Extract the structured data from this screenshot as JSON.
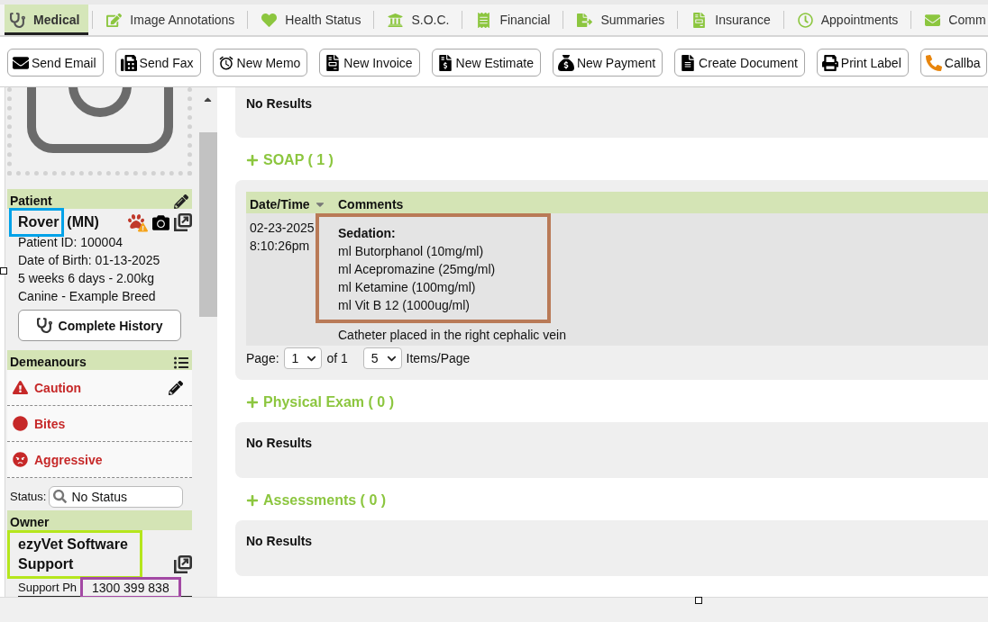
{
  "tabs": [
    {
      "label": "Medical",
      "selected": true
    },
    {
      "label": "Image Annotations",
      "selected": false
    },
    {
      "label": "Health Status",
      "selected": false
    },
    {
      "label": "S.O.C.",
      "selected": false
    },
    {
      "label": "Financial",
      "selected": false
    },
    {
      "label": "Summaries",
      "selected": false
    },
    {
      "label": "Insurance",
      "selected": false
    },
    {
      "label": "Appointments",
      "selected": false
    },
    {
      "label": "Comm",
      "selected": false
    }
  ],
  "toolbar": [
    "Send Email",
    "Send Fax",
    "New Memo",
    "New Invoice",
    "New Estimate",
    "New Payment",
    "Create Document",
    "Print Label",
    "Callba"
  ],
  "sidebar": {
    "patient": {
      "title": "Patient",
      "name": "Rover",
      "name_highlight": {
        "color": "#00a2e8"
      },
      "sex": "(MN)",
      "details": [
        "Patient ID: 100004",
        "Date of Birth: 01-13-2025",
        "5 weeks 6 days - 2.00kg",
        "Canine - Example Breed"
      ],
      "history_button": "Complete History"
    },
    "demeanours": {
      "title": "Demeanours",
      "items": [
        {
          "kind": "caution",
          "label": "Caution"
        },
        {
          "kind": "bites",
          "label": "Bites"
        },
        {
          "kind": "aggressive",
          "label": "Aggressive"
        }
      ]
    },
    "status": {
      "label": "Status:",
      "value": "No Status"
    },
    "owner": {
      "title": "Owner",
      "name": "ezyVet Software Support",
      "name_highlight": {
        "color": "#b5e61d"
      },
      "phone_label": "Support Ph",
      "phone": "1300 399 838",
      "phone_highlight": {
        "color": "#a349a4"
      }
    }
  },
  "main": {
    "top_panel": {
      "text": "No Results"
    },
    "sections": [
      {
        "kind": "table",
        "title": "SOAP ( 1 )",
        "table": {
          "columns": [
            {
              "label": "Date/Time",
              "sorted": true
            },
            {
              "label": "Comments",
              "sorted": false
            }
          ],
          "rows": [
            {
              "date": "02-23-2025",
              "time": "8:10:26pm",
              "comment": {
                "heading": "Sedation:",
                "lines": [
                  "ml Butorphanol (10mg/ml)",
                  "ml Acepromazine (25mg/ml)",
                  "ml Ketamine (100mg/ml)",
                  "ml Vit B 12 (1000ug/ml)"
                ],
                "highlight": {
                  "color": "#b97a57"
                },
                "note": "Catheter placed in the right cephalic vein"
              }
            }
          ]
        },
        "pagination": {
          "label": "Page:",
          "page": "1",
          "of": "of 1",
          "per_page": "5",
          "per_page_label": "Items/Page"
        }
      },
      {
        "kind": "empty",
        "title": "Physical Exam ( 0 )",
        "text": "No Results"
      },
      {
        "kind": "empty",
        "title": "Assessments ( 0 )",
        "text": "No Results"
      }
    ]
  }
}
